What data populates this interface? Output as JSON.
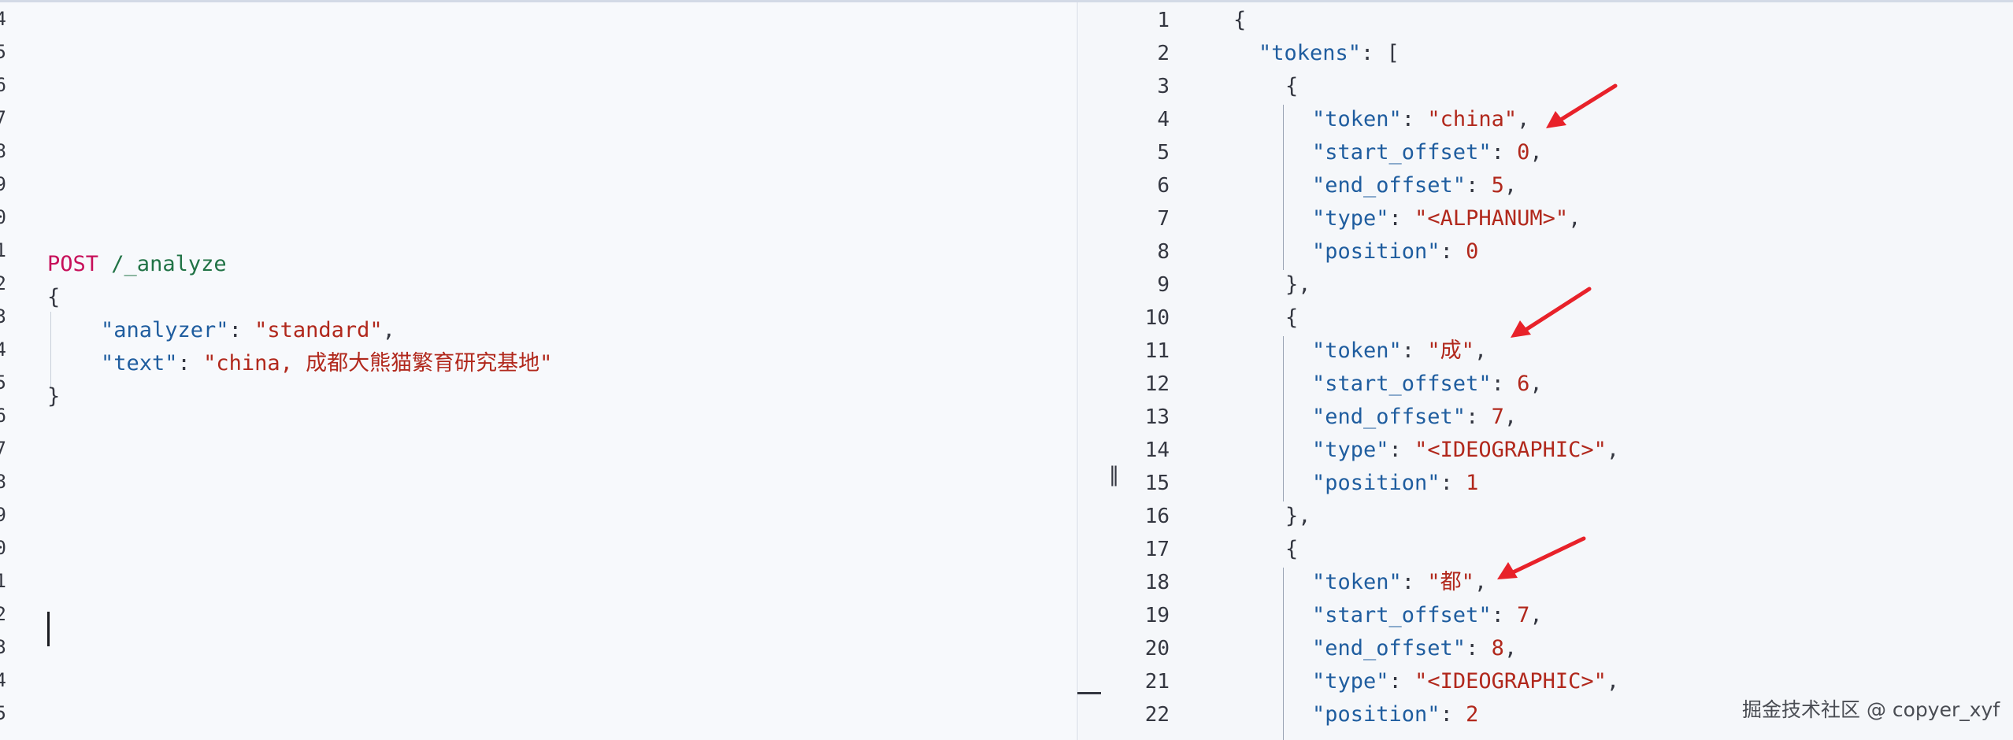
{
  "request": {
    "gutter_numbers": [
      "4",
      "5",
      "6",
      "7",
      "8",
      "9",
      "0",
      "1",
      "2",
      "3",
      "4",
      "5",
      "6",
      "7",
      "8",
      "9",
      "0",
      "1",
      "2",
      "3",
      "4",
      "5"
    ],
    "method": "POST",
    "path": "/_analyze",
    "open_brace": "{",
    "close_brace": "}",
    "fields": [
      {
        "key": "\"analyzer\"",
        "value": "\"standard\"",
        "trail": ","
      },
      {
        "key": "\"text\"",
        "value": "\"china, 成都大熊猫繁育研究基地\"",
        "trail": ""
      }
    ]
  },
  "resizer": {
    "handle_glyph": "‖"
  },
  "response": {
    "line_numbers": [
      "1",
      "2",
      "3",
      "4",
      "5",
      "6",
      "7",
      "8",
      "9",
      "10",
      "11",
      "12",
      "13",
      "14",
      "15",
      "16",
      "17",
      "18",
      "19",
      "20",
      "21",
      "22"
    ],
    "open_brace": "{",
    "tokens_key": "\"tokens\"",
    "tokens_open": "[",
    "object_open": "{",
    "object_close": "},",
    "tokens": [
      {
        "token": "\"china\"",
        "start_offset": "0",
        "end_offset": "5",
        "type": "\"<ALPHANUM>\"",
        "position": "0"
      },
      {
        "token": "\"成\"",
        "start_offset": "6",
        "end_offset": "7",
        "type": "\"<IDEOGRAPHIC>\"",
        "position": "1"
      },
      {
        "token": "\"都\"",
        "start_offset": "7",
        "end_offset": "8",
        "type": "\"<IDEOGRAPHIC>\"",
        "position": "2"
      }
    ],
    "labels": {
      "token": "\"token\"",
      "start_offset": "\"start_offset\"",
      "end_offset": "\"end_offset\"",
      "type": "\"type\"",
      "position": "\"position\""
    }
  },
  "annotations": {
    "arrow_color": "#e8222a",
    "arrow_icon": "red-arrow-icon"
  },
  "watermark": "掘金技术社区 @ copyer_xyf"
}
